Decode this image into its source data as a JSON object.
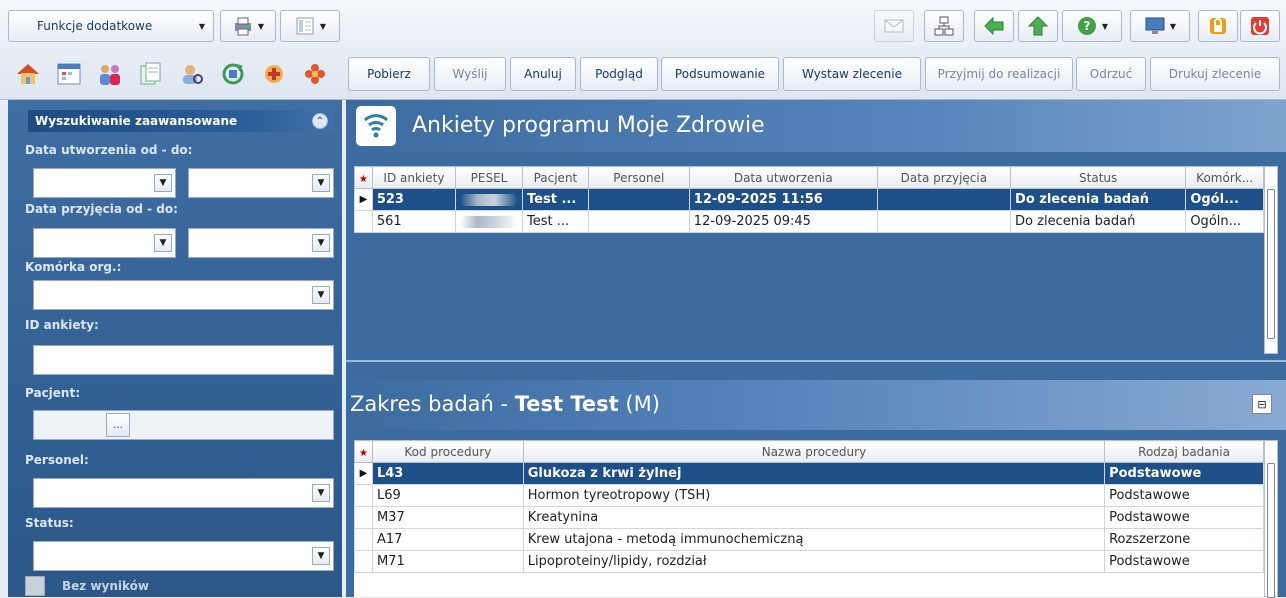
{
  "toolbar": {
    "functions_dropdown": "Funkcje dodatkowe",
    "actions": [
      {
        "label": "Pobierz",
        "enabled": true
      },
      {
        "label": "Wyślij",
        "enabled": false
      },
      {
        "label": "Anuluj",
        "enabled": true
      },
      {
        "label": "Podgląd",
        "enabled": true
      },
      {
        "label": "Podsumowanie",
        "enabled": true
      },
      {
        "label": "Wystaw zlecenie",
        "enabled": true
      },
      {
        "label": "Przyjmij do realizacji",
        "enabled": false
      },
      {
        "label": "Odrzuć",
        "enabled": false
      },
      {
        "label": "Drukuj zlecenie",
        "enabled": false
      }
    ],
    "icons": [
      "home-icon",
      "calendar-icon",
      "people-icon",
      "documents-icon",
      "user-search-icon",
      "refresh-icon",
      "medical-icon",
      "flower-icon"
    ],
    "right_icons": [
      "mail-icon",
      "hierarchy-icon",
      "back-arrow-icon",
      "up-arrow-icon",
      "help-icon",
      "monitor-icon",
      "lock-icon",
      "power-icon"
    ]
  },
  "search_panel": {
    "title": "Wyszukiwanie zaawansowane",
    "created_label": "Data utworzenia od - do:",
    "admitted_label": "Data przyjęcia od - do:",
    "org_unit_label": "Komórka org.:",
    "survey_id_label": "ID ankiety:",
    "patient_label": "Pacjent:",
    "patient_button": "...",
    "staff_label": "Personel:",
    "status_label": "Status:",
    "no_results_label": "Bez wyników"
  },
  "surveys": {
    "title": "Ankiety programu Moje Zdrowie",
    "columns": [
      "ID ankiety",
      "PESEL",
      "Pacjent",
      "Personel",
      "Data utworzenia",
      "Data przyjęcia",
      "Status",
      "Komórk..."
    ],
    "rows": [
      {
        "id": "523",
        "patient": "Test ...",
        "staff": "",
        "created": "12-09-2025 11:56",
        "admitted": "",
        "status": "Do zlecenia badań",
        "unit": "Ogól..."
      },
      {
        "id": "561",
        "patient": "Test ...",
        "staff": "",
        "created": "12-09-2025 09:45",
        "admitted": "",
        "status": "Do zlecenia badań",
        "unit": "Ogóln..."
      }
    ]
  },
  "tests": {
    "title_prefix": "Zakres badań - ",
    "patient_name": "Test Test",
    "patient_suffix": " (M)",
    "columns": [
      "Kod procedury",
      "Nazwa procedury",
      "Rodzaj badania"
    ],
    "rows": [
      {
        "code": "L43",
        "name": "Glukoza z krwi żylnej",
        "type": "Podstawowe"
      },
      {
        "code": "L69",
        "name": "Hormon tyreotropowy (TSH)",
        "type": "Podstawowe"
      },
      {
        "code": "M37",
        "name": "Kreatynina",
        "type": "Podstawowe"
      },
      {
        "code": "A17",
        "name": "Krew utajona - metodą immunochemiczną",
        "type": "Rozszerzone"
      },
      {
        "code": "M71",
        "name": "Lipoproteiny/lipidy, rozdział",
        "type": "Podstawowe"
      }
    ]
  }
}
